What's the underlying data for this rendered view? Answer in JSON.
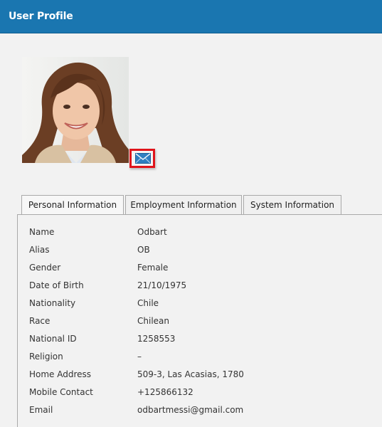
{
  "header": {
    "title": "User Profile"
  },
  "profile": {
    "photo_alt": "Profile photo"
  },
  "actions": {
    "email_icon": "envelope-icon"
  },
  "tabs": [
    {
      "label": "Personal Information",
      "active": true
    },
    {
      "label": "Employment Information",
      "active": false
    },
    {
      "label": "System Information",
      "active": false
    }
  ],
  "fields": [
    {
      "label": "Name",
      "value": "Odbart"
    },
    {
      "label": "Alias",
      "value": "OB"
    },
    {
      "label": "Gender",
      "value": "Female"
    },
    {
      "label": "Date of Birth",
      "value": "21/10/1975"
    },
    {
      "label": "Nationality",
      "value": "Chile"
    },
    {
      "label": "Race",
      "value": "Chilean"
    },
    {
      "label": "National ID",
      "value": "1258553"
    },
    {
      "label": "Religion",
      "value": "–"
    },
    {
      "label": "Home Address",
      "value": "509-3, Las Acasias, 1780"
    },
    {
      "label": "Mobile Contact",
      "value": "+125866132"
    },
    {
      "label": "Email",
      "value": "odbartmessi@gmail.com"
    }
  ],
  "colors": {
    "header": "#1a76b0",
    "highlight": "#e0141b",
    "envelope": "#2f7fc1"
  }
}
